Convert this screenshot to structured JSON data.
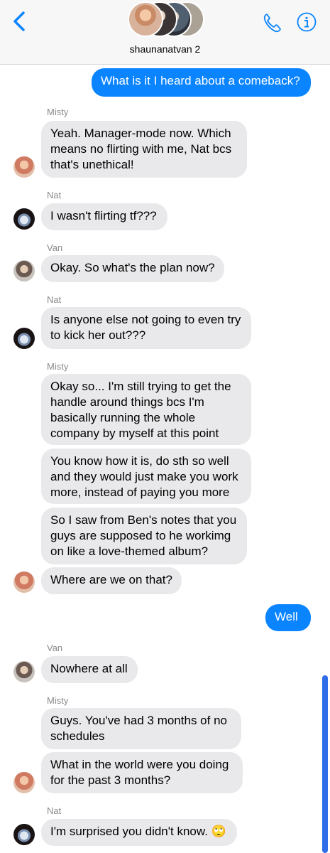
{
  "header": {
    "group_name": "shaunanatvan 2",
    "back_icon": "chevron-left-icon",
    "call_icon": "phone-icon",
    "info_icon": "info-icon",
    "accent_color": "#0a84ff"
  },
  "messages": [
    {
      "sender": "",
      "text": "What is it I heard about a comeback?",
      "direction": "outgoing"
    },
    {
      "sender": "Misty",
      "text": "Yeah. Manager-mode now. Which means no flirting with me, Nat bcs that's unethical!",
      "direction": "incoming"
    },
    {
      "sender": "Nat",
      "text": "I wasn't flirting tf???",
      "direction": "incoming"
    },
    {
      "sender": "Van",
      "text": "Okay. So what's the plan now?",
      "direction": "incoming"
    },
    {
      "sender": "Nat",
      "text": "Is anyone else not going to even try to kick her out???",
      "direction": "incoming"
    },
    {
      "sender": "Misty",
      "text": "Okay so... I'm still trying to get the handle around things bcs I'm basically running the whole company by myself at this point",
      "direction": "incoming"
    },
    {
      "sender": "",
      "text": "You know how it is, do sth so well and they would just make you work more, instead of paying you more",
      "direction": "incoming"
    },
    {
      "sender": "",
      "text": "So I saw from Ben's notes that you guys are supposed to he workimg on like a love-themed album?",
      "direction": "incoming"
    },
    {
      "sender": "",
      "text": "Where are we on that?",
      "direction": "incoming"
    },
    {
      "sender": "",
      "text": "Well",
      "direction": "outgoing"
    },
    {
      "sender": "Van",
      "text": "Nowhere at all",
      "direction": "incoming"
    },
    {
      "sender": "Misty",
      "text": "Guys. You've had 3 months of no schedules",
      "direction": "incoming"
    },
    {
      "sender": "",
      "text": "What in the world were you doing for the past 3 months?",
      "direction": "incoming"
    },
    {
      "sender": "Nat",
      "text": "I'm surprised you didn't know. 🙄",
      "direction": "incoming"
    }
  ]
}
